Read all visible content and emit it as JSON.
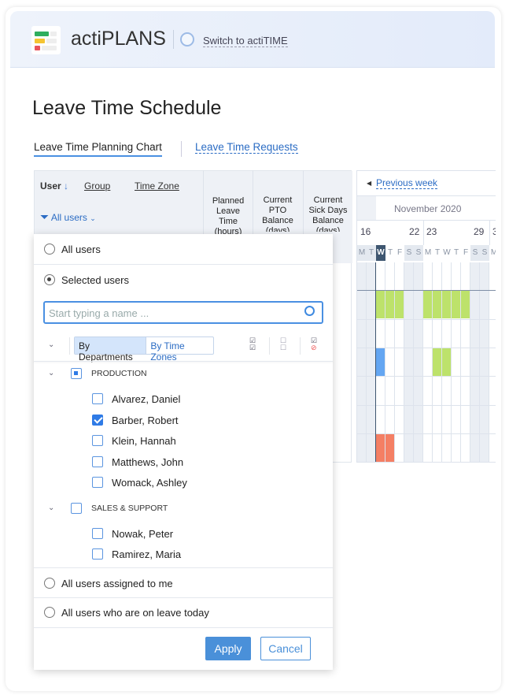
{
  "header": {
    "app_name": "actiPLANS",
    "switch_label": "Switch to actiTIME"
  },
  "page": {
    "title": "Leave Time Schedule"
  },
  "tabs": [
    {
      "label": "Leave Time Planning Chart",
      "active": true
    },
    {
      "label": "Leave Time Requests",
      "active": false
    }
  ],
  "table": {
    "sort_user": "User",
    "group": "Group",
    "time_zone": "Time Zone",
    "filter_label": "All users",
    "columns": [
      "Planned Leave Time (hours)",
      "Current PTO Balance (days)",
      "Current Sick Days Balance (days)"
    ]
  },
  "gantt": {
    "prev_week": "Previous week",
    "month": "November 2020",
    "dates": [
      "16",
      "22",
      "23",
      "29",
      "3"
    ],
    "days": [
      "M",
      "T",
      "W",
      "T",
      "F",
      "S",
      "S",
      "M",
      "T",
      "W",
      "T",
      "F",
      "S",
      "S",
      "M"
    ],
    "today_index": 2,
    "colors": {
      "green": "#bde26b",
      "blue": "#64a6f2",
      "red": "#f47f64"
    },
    "bars": [
      {
        "row": 1,
        "days": [
          2,
          3,
          4,
          7,
          8,
          9,
          10,
          11
        ],
        "color": "green"
      },
      {
        "row": 3,
        "days": [
          2
        ],
        "color": "blue"
      },
      {
        "row": 3,
        "days": [
          8,
          9
        ],
        "color": "green"
      },
      {
        "row": 6,
        "days": [
          2,
          3
        ],
        "color": "red"
      }
    ]
  },
  "dropdown": {
    "all_users": "All users",
    "selected_users": "Selected users",
    "search_placeholder": "Start typing a name ...",
    "by_departments": "By Departments",
    "by_time_zones": "By Time Zones",
    "groups": [
      {
        "name": "PRODUCTION",
        "state": "partial",
        "users": [
          {
            "name": "Alvarez, Daniel",
            "checked": false
          },
          {
            "name": "Barber, Robert",
            "checked": true
          },
          {
            "name": "Klein, Hannah",
            "checked": false
          },
          {
            "name": "Matthews, John",
            "checked": false
          },
          {
            "name": "Womack, Ashley",
            "checked": false
          }
        ]
      },
      {
        "name": "SALES & SUPPORT",
        "state": "none",
        "users": [
          {
            "name": "Nowak, Peter",
            "checked": false
          },
          {
            "name": "Ramirez, Maria",
            "checked": false
          }
        ]
      }
    ],
    "assigned_to_me": "All users assigned to me",
    "on_leave_today": "All users who are on leave today",
    "apply": "Apply",
    "cancel": "Cancel"
  }
}
